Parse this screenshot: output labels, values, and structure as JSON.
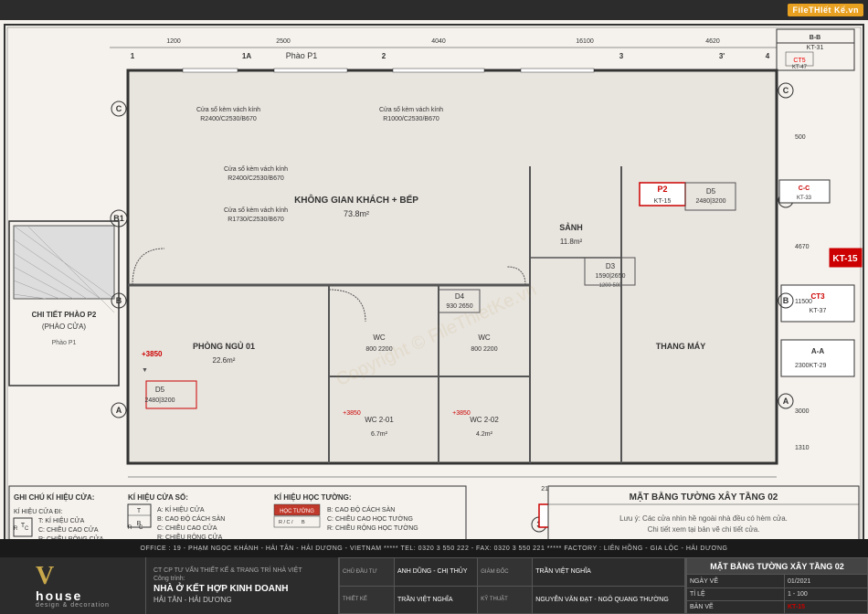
{
  "site": {
    "title": "FileTHIETKE.vn",
    "logo_text": "FileTHIết Kế.vn"
  },
  "top_bar": {
    "logo": "File Thiết Kế.vn"
  },
  "drawing": {
    "title": "MẶT BẰNG TƯỜNG XÂY TẦNG 02",
    "scale": "1 - 100",
    "code": "KT-15",
    "watermark": "Copyright © FileThietKe.vn"
  },
  "bottom_bar": {
    "company": "CT CP TƯ VẤN THIẾT KẾ & TRANG TRÍ NHÀ VIỆT",
    "logo_v": "V",
    "logo_house": "house",
    "logo_sub": "design & decoration",
    "project_label": "Công trình:",
    "project_name": "NHÀ Ở KẾT HỢP KINH DOANH",
    "location": "HẢI TÂN - HẢI DƯƠNG",
    "office": "OFFICE : 19 - PHẠM NGỌC KHÁNH - HẢI TÂN - HẢI DƯƠNG - VIETNAM ***** TEL: 0320 3 550 222 - FAX: 0320 3 550 221 ***** FACTORY : LIÊN HỒNG - GIA LỘC - HẢI DƯƠNG"
  },
  "table_rows": [
    {
      "label": "CHỦ ĐẦU TƯ",
      "value": "ANH DŨNG - CHỊ THỦY"
    },
    {
      "label": "GIÁM ĐỐC",
      "value": "TRẦN VIỆT NGHĨA"
    },
    {
      "label": "THIẾT KẾ",
      "value": "TRẦN VIỆT NGHĨA"
    },
    {
      "label": "KỸ THUẬT",
      "value": "NGUYỄN VĂN ĐẠT - NGÔ QUANG THƯỜNG"
    }
  ],
  "right_table": {
    "title": "MẶT BẰNG TƯỜNG XÂY TẦNG 02",
    "date_label": "NGÀY VẼ",
    "date_value": "01/2021",
    "scale_label": "TỈ LỆ",
    "scale_value": "1 - 100",
    "code_label": "BẢN VẼ",
    "code_value": "KT-15"
  },
  "legend": {
    "title": "GHI CHÚ KÍ HIỆU CỬA:",
    "door_label": "KÍ HIỆU CỬA ĐI:",
    "items": [
      {
        "symbol": "T",
        "desc": "T: KÍ HIỆU CỬA"
      },
      {
        "symbol": "R C",
        "desc": "C: CHIỀU CAO CỬA"
      },
      {
        "symbol": "",
        "desc": "R: CHIỀU RỘNG CỬA"
      }
    ],
    "window_label": "KÍ HIỆU CỬA SỔ:",
    "window_items": [
      {
        "col_t": "T",
        "col_b": "B",
        "desc": "A: KÍ HIỆU CỬA"
      },
      {
        "col_t": "R",
        "col_b": "C",
        "desc": "B: CAO ĐỘ CÁCH SÀN"
      },
      {
        "desc": "C: CHIỀU CAO CỬA"
      },
      {
        "desc": "R: CHIỀU RỘNG CỬA"
      }
    ],
    "wall_label": "KÍ HIỆU HỌC TƯỜNG:",
    "wall_items": [
      {
        "desc": "HỌC TƯỜNG"
      },
      {
        "desc": "B: CAO ĐỘ CÁCH SÀN"
      },
      {
        "desc": "C: CHIỀU CAO HỌC TƯỜNG"
      },
      {
        "desc": "R: CHIỀU RỘNG HỌC TƯỜNG"
      }
    ]
  },
  "rooms": [
    {
      "name": "KHÔNG GIAN KHÁCH + BẾP",
      "area": "73.8m²"
    },
    {
      "name": "SẢNH",
      "area": "11.8m²"
    },
    {
      "name": "PHÒNG NGỦ 01",
      "area": "22.6m²"
    },
    {
      "name": "WC 2-01",
      "area": "6.7m²"
    },
    {
      "name": "WC 2-02",
      "area": "4.2m²"
    },
    {
      "name": "THANG MÁY",
      "area": ""
    }
  ],
  "notes": {
    "text": "Lưu ý: Các cửa nhìn hề ngoài nhà đều có hèm cửa. Chi tiết xem tại bản vẽ chi tiết cửa."
  }
}
